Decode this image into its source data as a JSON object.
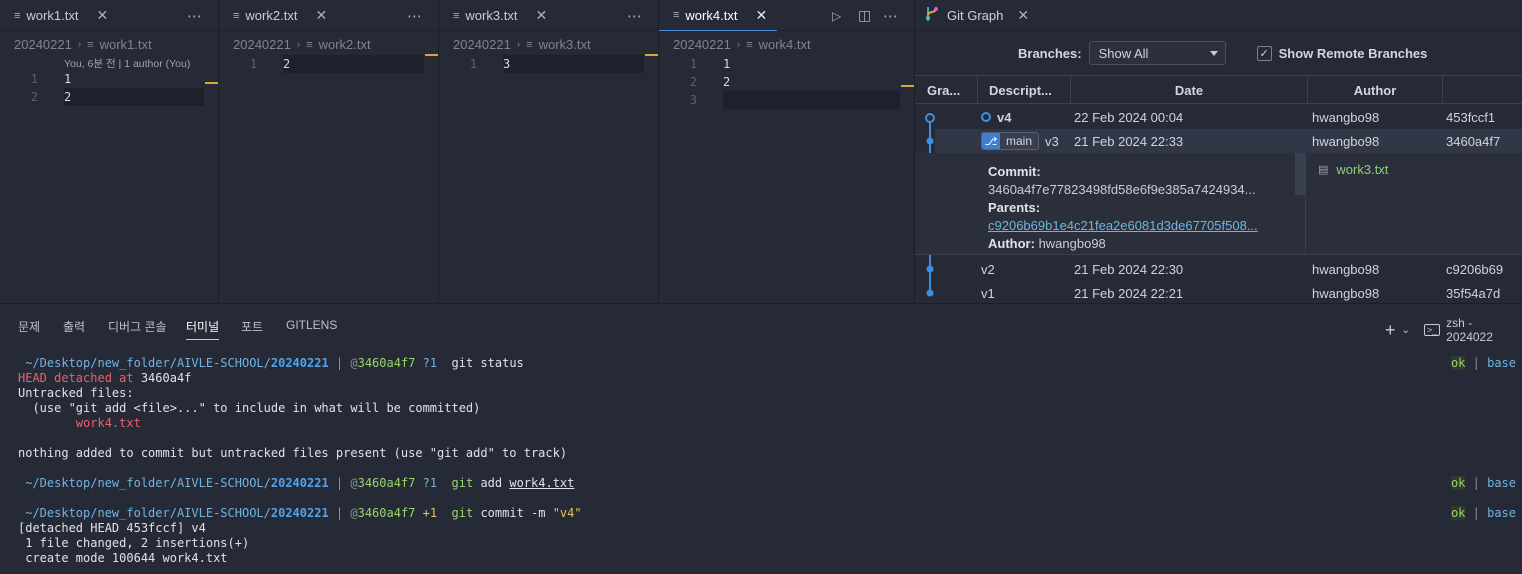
{
  "editors": [
    {
      "tab": "work1.txt",
      "breadcrumb": {
        "folder": "20240221",
        "file": "work1.txt"
      },
      "blame": "You, 6분 전 | 1 author (You)",
      "lines": [
        {
          "n": "1",
          "t": "1"
        },
        {
          "n": "2",
          "t": "2"
        }
      ]
    },
    {
      "tab": "work2.txt",
      "breadcrumb": {
        "folder": "20240221",
        "file": "work2.txt"
      },
      "lines": [
        {
          "n": "1",
          "t": "2"
        }
      ]
    },
    {
      "tab": "work3.txt",
      "breadcrumb": {
        "folder": "20240221",
        "file": "work3.txt"
      },
      "lines": [
        {
          "n": "1",
          "t": "3"
        }
      ]
    },
    {
      "tab": "work4.txt",
      "breadcrumb": {
        "folder": "20240221",
        "file": "work4.txt"
      },
      "lines": [
        {
          "n": "1",
          "t": "1"
        },
        {
          "n": "2",
          "t": "2"
        },
        {
          "n": "3",
          "t": ""
        }
      ]
    }
  ],
  "git_graph": {
    "tab": "Git Graph",
    "branches_label": "Branches:",
    "branches_value": "Show All",
    "remote_label": "Show Remote Branches",
    "columns": {
      "graph": "Gra...",
      "desc": "Descript...",
      "date": "Date",
      "author": "Author"
    },
    "commits": [
      {
        "desc": "v4",
        "date": "22 Feb 2024 00:04",
        "author": "hwangbo98",
        "hash": "453fccf1"
      },
      {
        "badge": "main",
        "desc": "v3",
        "date": "21 Feb 2024 22:33",
        "author": "hwangbo98",
        "hash": "3460a4f7"
      },
      {
        "desc": "v2",
        "date": "21 Feb 2024 22:30",
        "author": "hwangbo98",
        "hash": "c9206b69"
      },
      {
        "desc": "v1",
        "date": "21 Feb 2024 22:21",
        "author": "hwangbo98",
        "hash": "35f54a7d"
      }
    ],
    "detail": {
      "commit_label": "Commit:",
      "commit": "3460a4f7e77823498fd58e6f9e385a7424934...",
      "parents_label": "Parents:",
      "parents": "c9206b69b1e4c21fea2e6081d3de67705f508...",
      "author_label": "Author:",
      "author": "hwangbo98",
      "file": "work3.txt"
    }
  },
  "panel": {
    "tabs": [
      "문제",
      "출력",
      "디버그 콘솔",
      "터미널",
      "포트",
      "GITLENS"
    ],
    "active_tab": "터미널",
    "shell": "zsh - 2024022"
  },
  "terminal": {
    "path_prefix": "~/Desktop/new_folder/AIVLE-SCHOOL/",
    "path_dir": "20240221",
    "sep": " | ",
    "at": "@",
    "sha": "3460a4f7",
    "status_ok": "ok",
    "status_base": "base",
    "cmd1_flag": "?1",
    "cmd1": "git status",
    "out1": [
      "HEAD detached at ",
      "3460a4f",
      "Untracked files:",
      "  (use \"git add <file>...\" to include in what will be committed)",
      "        work4.txt",
      "nothing added to commit but untracked files present (use \"git add\" to track)"
    ],
    "cmd2_git": "git",
    "cmd2_add": " add ",
    "cmd2_file": "work4.txt",
    "cmd3_flag": "+1",
    "cmd3_git": "git",
    "cmd3_rest": " commit -m ",
    "cmd3_msg": "\"v4\"",
    "out3": [
      "[detached HEAD 453fccf] v4",
      " 1 file changed, 2 insertions(+)",
      " create mode 100644 work4.txt"
    ]
  },
  "colors": {
    "background": "#262a37",
    "accent_blue": "#3f7fd1",
    "green": "#9ad56b",
    "red": "#ef5e6b",
    "modified_marker": "#d6a833"
  }
}
